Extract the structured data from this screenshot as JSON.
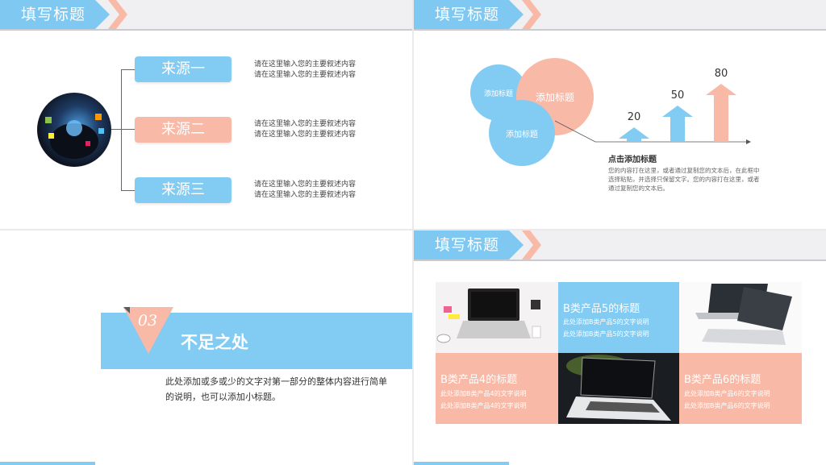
{
  "colors": {
    "blue": "#82cbf3",
    "pink": "#f9b9a7",
    "header_bg": "#f0f0f2"
  },
  "slide1": {
    "header_title": "填写标题",
    "sources": [
      {
        "label": "来源一",
        "desc1": "请在这里输入您的主要叙述内容",
        "desc2": "请在这里输入您的主要叙述内容"
      },
      {
        "label": "来源二",
        "desc1": "请在这里输入您的主要叙述内容",
        "desc2": "请在这里输入您的主要叙述内容"
      },
      {
        "label": "来源三",
        "desc1": "请在这里输入您的主要叙述内容",
        "desc2": "请在这里输入您的主要叙述内容"
      }
    ]
  },
  "slide2": {
    "header_title": "填写标题",
    "bubbles": [
      "添加标题",
      "添加标题",
      "添加标题"
    ],
    "chart_data": {
      "type": "bar",
      "categories": [
        "",
        "",
        ""
      ],
      "values": [
        20,
        50,
        80
      ]
    },
    "title": "点击添加标题",
    "body": "您的内容打在这里，或者通过复制您的文本后，在此框中选择粘贴，并选择只保留文字。您的内容打在这里，或者通过复制您的文本后。"
  },
  "slide3": {
    "number": "03",
    "title": "不足之处",
    "body": "此处添加或多或少的文字对第一部分的整体内容进行简单的说明，也可以添加小标题。"
  },
  "slide4": {
    "header_title": "填写标题",
    "products": [
      {
        "title": "B类产品5的标题",
        "line1": "此处添加B类产品5的文字说明",
        "line2": "此处添加B类产品5的文字说明"
      },
      {
        "title": "B类产品4的标题",
        "line1": "此处添加B类产品4的文字说明",
        "line2": "此处添加B类产品4的文字说明"
      },
      {
        "title": "B类产品6的标题",
        "line1": "此处添加B类产品6的文字说明",
        "line2": "此处添加B类产品6的文字说明"
      }
    ]
  }
}
